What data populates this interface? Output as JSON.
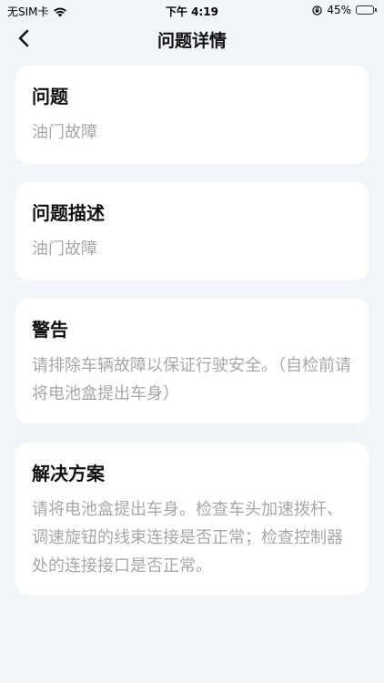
{
  "status_bar": {
    "carrier": "无SIM卡",
    "time": "下午 4:19",
    "battery_percent": "45%",
    "battery_level": 0.45,
    "battery_color": "#34c759"
  },
  "nav": {
    "title": "问题详情",
    "back_icon": "chevron-left-icon"
  },
  "sections": [
    {
      "title": "问题",
      "content": "油门故障"
    },
    {
      "title": "问题描述",
      "content": "油门故障"
    },
    {
      "title": "警告",
      "content": "请排除车辆故障以保证行驶安全。（自检前请将电池盒提出车身）"
    },
    {
      "title": "解决方案",
      "content": "请将电池盒提出车身。检查车头加速拨杆、调速旋钮的线束连接是否正常；检查控制器处的连接接口是否正常。"
    }
  ],
  "colors": {
    "background": "#f1f4f9",
    "card": "#ffffff",
    "title_text": "#111111",
    "body_text": "#a7a7a7"
  }
}
